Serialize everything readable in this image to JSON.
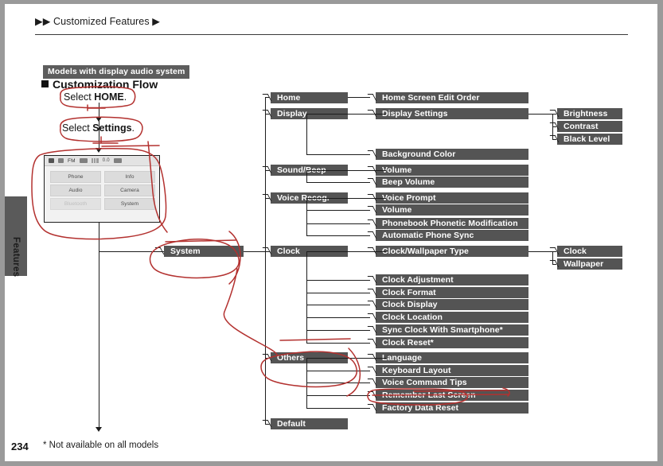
{
  "page": {
    "breadcrumb": "▶▶ Customized Features ▶",
    "folio": "234",
    "footnote": "* Not available on all models",
    "side_tab_label": "Features",
    "model_banner": "Models with display audio system",
    "section_heading": "Customization Flow",
    "accent_ink_color": "#b3312f",
    "node_bar_color": "#545454",
    "banner_color": "#5d5d5d"
  },
  "flow_steps": [
    {
      "id": "select-home",
      "text_prefix": "Select ",
      "text_bold": "HOME",
      "text_suffix": "."
    },
    {
      "id": "select-settings",
      "text_prefix": "Select ",
      "text_bold": "Settings",
      "text_suffix": "."
    }
  ],
  "device_screen": {
    "status_text_1": "FM",
    "status_text_2": "0.0",
    "buttons": [
      {
        "label": "Phone",
        "disabled": false
      },
      {
        "label": "Info",
        "disabled": false
      },
      {
        "label": "Audio",
        "disabled": false
      },
      {
        "label": "Camera",
        "disabled": false
      },
      {
        "label": "Bluetooth",
        "disabled": true
      },
      {
        "label": "System",
        "disabled": false
      }
    ]
  },
  "tree": {
    "root": {
      "label": "System"
    },
    "level2": [
      {
        "label": "Home"
      },
      {
        "label": "Display"
      },
      {
        "label": "Sound/Beep"
      },
      {
        "label": "Voice Recog."
      },
      {
        "label": "Clock"
      },
      {
        "label": "Others"
      },
      {
        "label": "Default"
      }
    ],
    "level3": [
      {
        "label": "Home Screen Edit Order"
      },
      {
        "label": "Display Settings"
      },
      {
        "label": "Background Color"
      },
      {
        "label": "Volume"
      },
      {
        "label": "Beep Volume"
      },
      {
        "label": "Voice Prompt"
      },
      {
        "label": "Volume"
      },
      {
        "label": "Phonebook Phonetic Modification"
      },
      {
        "label": "Automatic Phone Sync"
      },
      {
        "label": "Clock/Wallpaper Type"
      },
      {
        "label": "Clock Adjustment"
      },
      {
        "label": "Clock Format"
      },
      {
        "label": "Clock Display"
      },
      {
        "label": "Clock Location"
      },
      {
        "label": "Sync Clock With Smartphone*"
      },
      {
        "label": "Clock Reset*"
      },
      {
        "label": "Language"
      },
      {
        "label": "Keyboard Layout"
      },
      {
        "label": "Voice Command Tips"
      },
      {
        "label": "Remember Last Screen"
      },
      {
        "label": "Factory Data Reset"
      }
    ],
    "level4": [
      {
        "label": "Brightness"
      },
      {
        "label": "Contrast"
      },
      {
        "label": "Black Level"
      },
      {
        "label": "Clock"
      },
      {
        "label": "Wallpaper"
      }
    ]
  }
}
